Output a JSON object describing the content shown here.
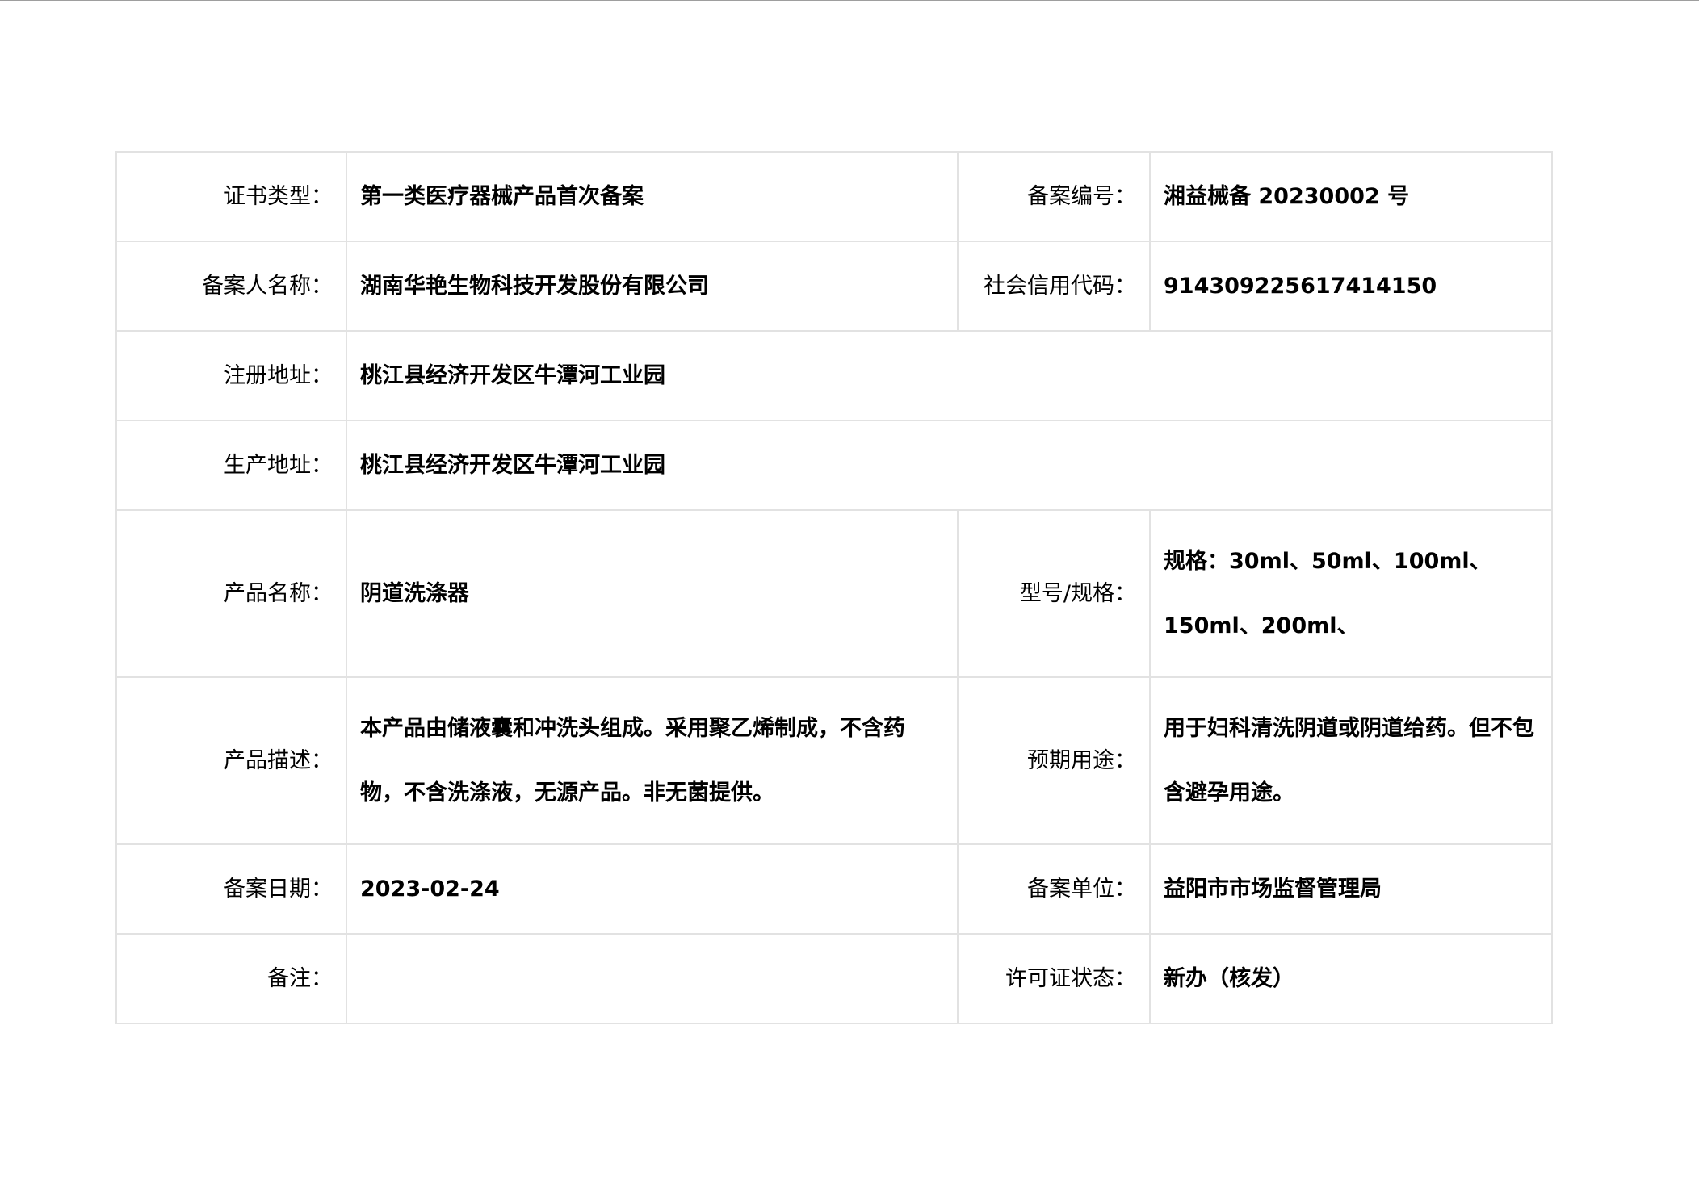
{
  "record": {
    "cert_type_label": "证书类型：",
    "cert_type_value": "第一类医疗器械产品首次备案",
    "record_no_label": "备案编号：",
    "record_no_value": "湘益械备 20230002 号",
    "filer_name_label": "备案人名称：",
    "filer_name_value": "湖南华艳生物科技开发股份有限公司",
    "credit_code_label": "社会信用代码：",
    "credit_code_value": "914309225617414150",
    "reg_address_label": "注册地址：",
    "reg_address_value": "桃江县经济开发区牛潭河工业园",
    "prod_address_label": "生产地址：",
    "prod_address_value": "桃江县经济开发区牛潭河工业园",
    "product_name_label": "产品名称：",
    "product_name_value": "阴道洗涤器",
    "model_spec_label": "型号/规格：",
    "model_spec_value": "规格：30ml、50ml、100ml、150ml、200ml、",
    "product_desc_label": "产品描述：",
    "product_desc_value": "本产品由储液囊和冲洗头组成。采用聚乙烯制成，不含药物，不含洗涤液，无源产品。非无菌提供。",
    "intended_use_label": "预期用途：",
    "intended_use_value": "用于妇科清洗阴道或阴道给药。但不包含避孕用途。",
    "record_date_label": "备案日期：",
    "record_date_value": "2023-02-24",
    "record_unit_label": "备案单位：",
    "record_unit_value": "益阳市市场监督管理局",
    "remarks_label": "备注：",
    "remarks_value": "",
    "license_status_label": "许可证状态：",
    "license_status_value": "新办（核发）"
  }
}
